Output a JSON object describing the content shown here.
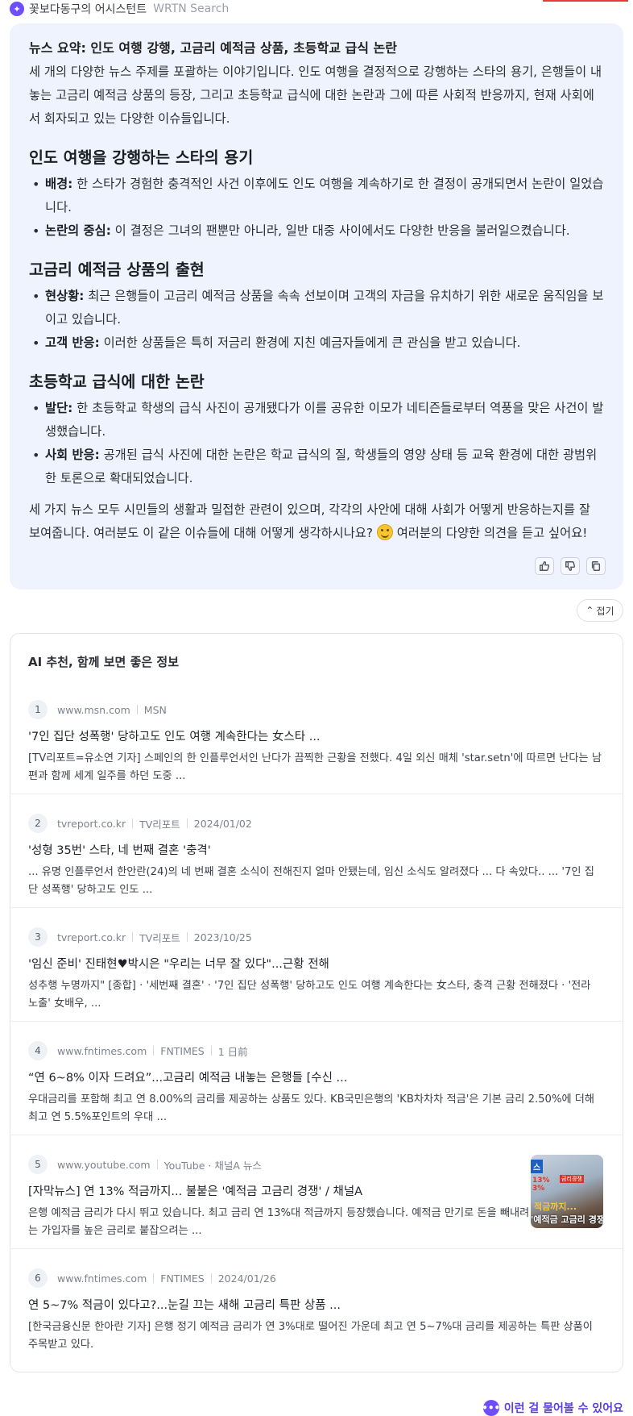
{
  "header": {
    "agent_name": "꽃보다동구의 어시스턴트",
    "brand": "WRTN Search"
  },
  "summary": {
    "title": "뉴스 요약: 인도 여행 강행, 고금리 예적금 상품, 초등학교 급식 논란",
    "intro": "세 개의 다양한 뉴스 주제를 포괄하는 이야기입니다. 인도 여행을 결정적으로 강행하는 스타의 용기, 은행들이 내놓는 고금리 예적금 상품의 등장, 그리고 초등학교 급식에 대한 논란과 그에 따른 사회적 반응까지, 현재 사회에서 회자되고 있는 다양한 이슈들입니다.",
    "sections": [
      {
        "heading": "인도 여행을 강행하는 스타의 용기",
        "bullets": [
          {
            "label": "배경:",
            "text": " 한 스타가 경험한 충격적인 사건 이후에도 인도 여행을 계속하기로 한 결정이 공개되면서 논란이 일었습니다."
          },
          {
            "label": "논란의 중심:",
            "text": " 이 결정은 그녀의 팬뿐만 아니라, 일반 대중 사이에서도 다양한 반응을 불러일으켰습니다."
          }
        ]
      },
      {
        "heading": "고금리 예적금 상품의 출현",
        "bullets": [
          {
            "label": "현상황:",
            "text": " 최근 은행들이 고금리 예적금 상품을 속속 선보이며 고객의 자금을 유치하기 위한 새로운 움직임을 보이고 있습니다."
          },
          {
            "label": "고객 반응:",
            "text": " 이러한 상품들은 특히 저금리 환경에 지친 예금자들에게 큰 관심을 받고 있습니다."
          }
        ]
      },
      {
        "heading": "초등학교 급식에 대한 논란",
        "bullets": [
          {
            "label": "발단:",
            "text": " 한 초등학교 학생의 급식 사진이 공개됐다가 이를 공유한 이모가 네티즌들로부터 역풍을 맞은 사건이 발생했습니다."
          },
          {
            "label": "사회 반응:",
            "text": " 공개된 급식 사진에 대한 논란은 학교 급식의 질, 학생들의 영양 상태 등 교육 환경에 대한 광범위한 토론으로 확대되었습니다."
          }
        ]
      }
    ],
    "closing_before": "세 가지 뉴스 모두 시민들의 생활과 밀접한 관련이 있으며, 각각의 사안에 대해 사회가 어떻게 반응하는지를 잘 보여줍니다. 여러분도 이 같은 이슈들에 대해 어떻게 생각하시나요? ",
    "closing_after": " 여러분의 다양한 의견을 듣고 싶어요!",
    "emoji_icon": "smiling-face-emoji"
  },
  "collapse_label": "접기",
  "related": {
    "title": "AI 추천, 함께 보면 좋은 정보",
    "items": [
      {
        "num": "1",
        "domain": "www.msn.com",
        "source": "MSN",
        "date": "",
        "title": "'7인 집단 성폭행' 당하고도 인도 여행 계속한다는 女스타 ...",
        "desc": "[TV리포트=유소연 기자] 스페인의 한 인플루언서인 난다가 끔찍한 근황을 전했다. 4일 외신 매체 'star.setn'에 따르면 난다는 남편과 함께 세계 일주를 하던 도중 ..."
      },
      {
        "num": "2",
        "domain": "tvreport.co.kr",
        "source": "TV리포트",
        "date": "2024/01/02",
        "title": "'성형 35번' 스타, 네 번째 결혼 '충격'",
        "desc": "... 유명 인플루언서 한안란(24)의 네 번째 결혼 소식이 전해진지 얼마 안됐는데, 임신 소식도 알려졌다 ... 다 속았다.. ... '7인 집단 성폭행' 당하고도 인도 ..."
      },
      {
        "num": "3",
        "domain": "tvreport.co.kr",
        "source": "TV리포트",
        "date": "2023/10/25",
        "title": "'임신 준비' 진태현♥박시은 \"우리는 너무 잘 있다\"...근황 전해",
        "desc": "성추행 누명까지\" [종합] · '세번째 결혼' · '7인 집단 성폭행' 당하고도 인도 여행 계속한다는 女스타, 충격 근황 전해졌다 · '전라 노출' 女배우, ..."
      },
      {
        "num": "4",
        "domain": "www.fntimes.com",
        "source": "FNTIMES",
        "date": "1 日前",
        "title": "“연 6~8% 이자 드려요”...고금리 예적금 내놓는 은행들 [수신 ...",
        "desc": "우대금리를 포함해 최고 연 8.00%의 금리를 제공하는 상품도 있다. KB국민은행의 'KB차차차 적금'은 기본 금리 2.50%에 더해 최고 연 5.5%포인트의 우대 ..."
      },
      {
        "num": "5",
        "domain": "www.youtube.com",
        "source": "YouTube · 채널A 뉴스",
        "date": "",
        "title": "[자막뉴스] 연 13% 적금까지... 불붙은 '예적금 고금리 경쟁' / 채널A",
        "desc": "은행 예적금 금리가 다시 뛰고 있습니다. 최고 금리 연 13%대 적금까지 등장했습니다. 예적금 만기로 돈을 빼내려는 가입자를 높은 금리로 붙잡으려는 ...",
        "thumb": {
          "badge": "스",
          "rate1": "13%",
          "rate2": "3%",
          "tag": "금리경쟁",
          "line1": "적금까지...",
          "line2": "'예적금 고금리 경쟁"
        }
      },
      {
        "num": "6",
        "domain": "www.fntimes.com",
        "source": "FNTIMES",
        "date": "2024/01/26",
        "title": "연 5~7% 적금이 있다고?...눈길 끄는 새해 고금리 특판 상품 ...",
        "desc": "[한국금융신문 한아란 기자] 은행 정기 예적금 금리가 연 3%대로 떨어진 가운데 최고 연 5~7%대 금리를 제공하는 특판 상품이 주목받고 있다."
      }
    ]
  },
  "footer": {
    "link_label": "이런 걸 물어볼 수 있어요"
  }
}
